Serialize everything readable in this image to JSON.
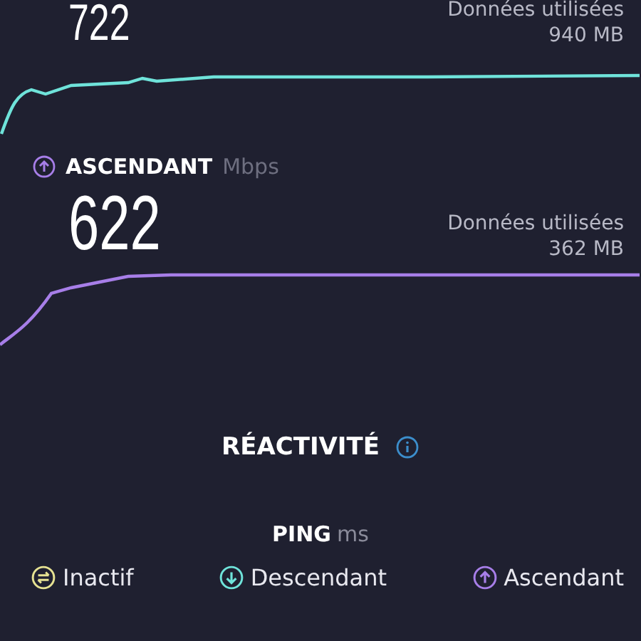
{
  "download": {
    "kind": "download",
    "value": "722",
    "data_label": "Données utilisées",
    "data_value": "940 MB"
  },
  "upload": {
    "kind": "upload",
    "label": "ASCENDANT",
    "unit": "Mbps",
    "value": "622",
    "data_label": "Données utilisées",
    "data_value": "362 MB"
  },
  "responsiveness": {
    "title": "RÉACTIVITÉ"
  },
  "ping": {
    "label": "PING",
    "unit": "ms"
  },
  "legend": [
    {
      "kind": "idle",
      "label": "Inactif",
      "color": "#e6e292"
    },
    {
      "kind": "download",
      "label": "Descendant",
      "color": "#6fe3da"
    },
    {
      "kind": "upload",
      "label": "Ascendant",
      "color": "#a77ee8"
    }
  ]
}
